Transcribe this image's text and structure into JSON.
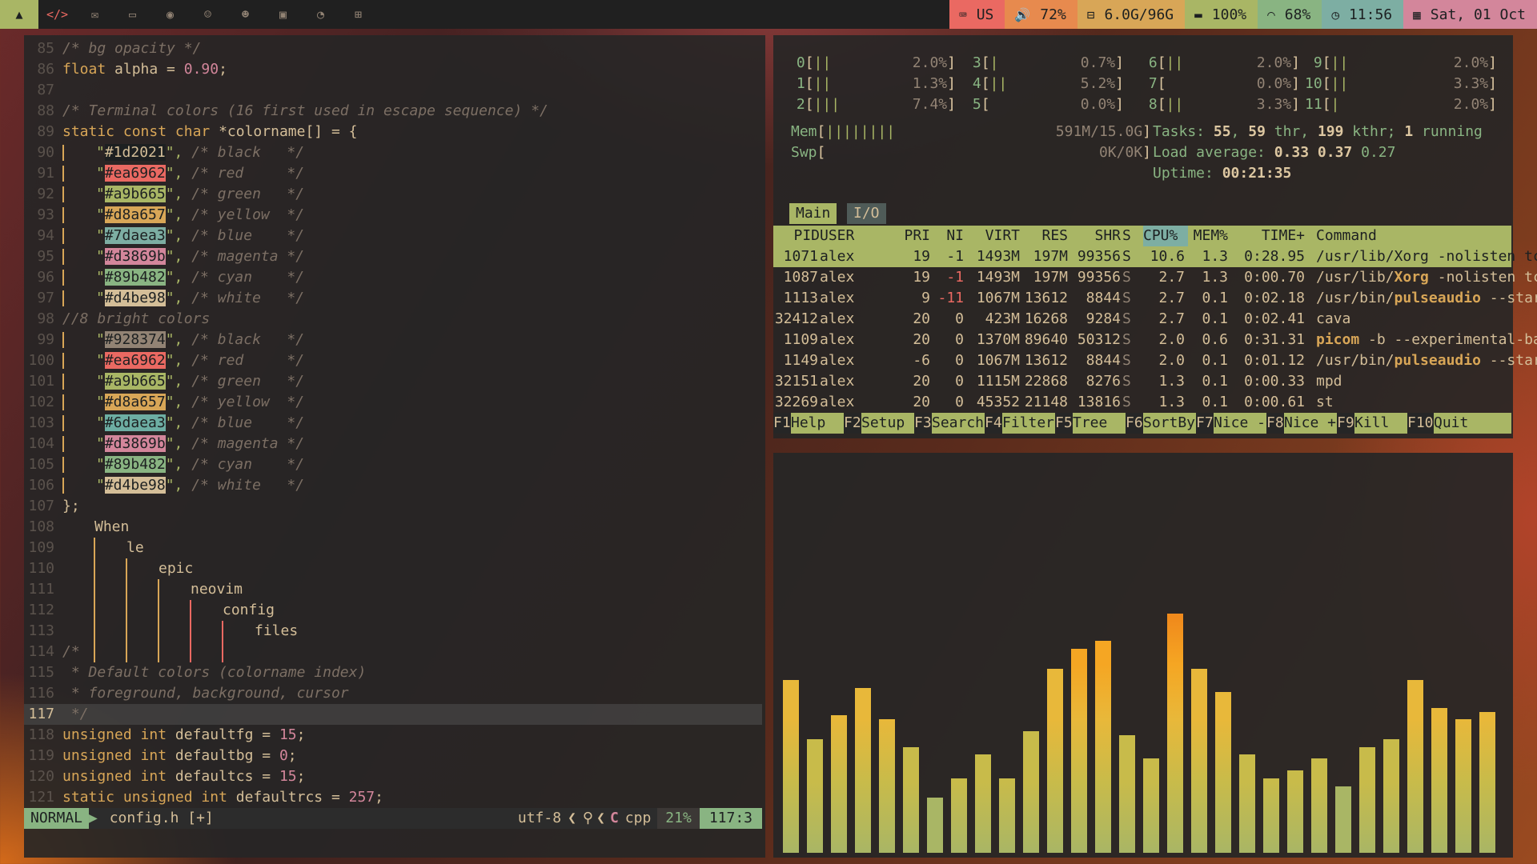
{
  "topbar": {
    "left_icons": [
      "arch-logo-icon",
      "code-icon",
      "mail-icon",
      "folder-icon",
      "eye-icon",
      "discord-icon",
      "github-icon",
      "lock-icon",
      "rss-icon",
      "grid-icon"
    ],
    "keyboard": "US",
    "volume": "72%",
    "disk": "6.0G/96G",
    "battery": "100%",
    "wifi": "68%",
    "time": "11:56",
    "date": "Sat, 01 Oct",
    "colors": {
      "keyboard": "#ea6962",
      "volume": "#e78a4e",
      "disk": "#d8a657",
      "battery": "#a9b665",
      "wifi": "#89b482",
      "time": "#7daea3",
      "date": "#d3869b"
    }
  },
  "editor": {
    "lines": [
      {
        "n": "85"
      },
      {
        "n": "86"
      },
      {
        "n": "87"
      },
      {
        "n": "88"
      },
      {
        "n": "89"
      },
      {
        "n": "90"
      },
      {
        "n": "91"
      },
      {
        "n": "92"
      },
      {
        "n": "93"
      },
      {
        "n": "94"
      },
      {
        "n": "95"
      },
      {
        "n": "96"
      },
      {
        "n": "97"
      },
      {
        "n": "98"
      },
      {
        "n": "99"
      },
      {
        "n": "100"
      },
      {
        "n": "101"
      },
      {
        "n": "102"
      },
      {
        "n": "103"
      },
      {
        "n": "104"
      },
      {
        "n": "105"
      },
      {
        "n": "106"
      },
      {
        "n": "107"
      },
      {
        "n": "108"
      },
      {
        "n": "109"
      },
      {
        "n": "110"
      },
      {
        "n": "111"
      },
      {
        "n": "112"
      },
      {
        "n": "113"
      },
      {
        "n": "114"
      },
      {
        "n": "115"
      },
      {
        "n": "116"
      },
      {
        "n": "117"
      },
      {
        "n": "118"
      },
      {
        "n": "119"
      },
      {
        "n": "120"
      },
      {
        "n": "121"
      }
    ],
    "text": {
      "l85": "/* bg opacity */",
      "l86_kw": "float",
      "l86_rest": " alpha = ",
      "l86_num": "0.90",
      "l86_end": ";",
      "l88": "/* Terminal colors (16 first used in escape sequence) */",
      "l89_a": "static const ",
      "l89_b": "char",
      "l89_c": " *colorname[] = {",
      "l107": "};",
      "l114": "/*",
      "l115": " * Default colors (colorname index)",
      "l116": " * foreground, background, cursor",
      "l117": " */",
      "l118_a": "unsigned ",
      "l118_b": "int",
      "l118_c": " defaultfg = ",
      "l118_num": "15",
      "l118_e": ";",
      "l119_a": "unsigned ",
      "l119_b": "int",
      "l119_c": " defaultbg = ",
      "l119_num": "0",
      "l119_e": ";",
      "l120_a": "unsigned ",
      "l120_b": "int",
      "l120_c": " defaultcs = ",
      "l120_num": "15",
      "l120_e": ";",
      "l121_a": "static unsigned ",
      "l121_b": "int",
      "l121_c": " defaultrcs = ",
      "l121_num": "257",
      "l121_e": ";",
      "l98": "//8 bright colors"
    },
    "colors": [
      {
        "hex": "#1d2021",
        "comment": "/* black   */"
      },
      {
        "hex": "#ea6962",
        "comment": "/* red     */"
      },
      {
        "hex": "#a9b665",
        "comment": "/* green   */"
      },
      {
        "hex": "#d8a657",
        "comment": "/* yellow  */"
      },
      {
        "hex": "#7daea3",
        "comment": "/* blue    */"
      },
      {
        "hex": "#d3869b",
        "comment": "/* magenta */"
      },
      {
        "hex": "#89b482",
        "comment": "/* cyan    */"
      },
      {
        "hex": "#d4be98",
        "comment": "/* white   */"
      }
    ],
    "bright_colors": [
      {
        "hex": "#928374",
        "comment": "/* black   */"
      },
      {
        "hex": "#ea6962",
        "comment": "/* red     */"
      },
      {
        "hex": "#a9b665",
        "comment": "/* green   */"
      },
      {
        "hex": "#d8a657",
        "comment": "/* yellow  */"
      },
      {
        "hex": "#6daea3",
        "comment": "/* blue    */"
      },
      {
        "hex": "#d3869b",
        "comment": "/* magenta */"
      },
      {
        "hex": "#89b482",
        "comment": "/* cyan    */"
      },
      {
        "hex": "#d4be98",
        "comment": "/* white   */"
      }
    ],
    "tree": [
      "When",
      "le",
      "epic",
      "neovim",
      "config",
      "files"
    ],
    "status": {
      "mode": "NORMAL",
      "file": "config.h [+]",
      "encoding": "utf-8",
      "filetype": "cpp",
      "percent": "21%",
      "position": "117:3"
    }
  },
  "htop": {
    "cpus": [
      {
        "id": "0",
        "bar": "||",
        "pct": "2.0%"
      },
      {
        "id": "1",
        "bar": "||",
        "pct": "1.3%"
      },
      {
        "id": "2",
        "bar": "|||",
        "pct": "7.4%"
      },
      {
        "id": "3",
        "bar": "|",
        "pct": "0.7%"
      },
      {
        "id": "4",
        "bar": "||",
        "pct": "5.2%"
      },
      {
        "id": "5",
        "bar": "",
        "pct": "0.0%"
      },
      {
        "id": "6",
        "bar": "||",
        "pct": "2.0%"
      },
      {
        "id": "7",
        "bar": "",
        "pct": "0.0%"
      },
      {
        "id": "8",
        "bar": "||",
        "pct": "3.3%"
      },
      {
        "id": "9",
        "bar": "||",
        "pct": "2.0%"
      },
      {
        "id": "10",
        "bar": "||",
        "pct": "3.3%"
      },
      {
        "id": "11",
        "bar": "|",
        "pct": "2.0%"
      }
    ],
    "mem": {
      "label": "Mem",
      "bar": "||||||||",
      "value": "591M/15.0G"
    },
    "swp": {
      "label": "Swp",
      "value": "0K/0K"
    },
    "tasks": {
      "label": "Tasks: ",
      "tasks": "55",
      "sep": ", ",
      "thr": "59",
      "thr_label": " thr, ",
      "kthr": "199",
      "kthr_label": " kthr; ",
      "running": "1",
      "running_label": " running"
    },
    "load": {
      "label": "Load average: ",
      "a": "0.33",
      "b": "0.37",
      "c": "0.27"
    },
    "uptime": {
      "label": "Uptime: ",
      "value": "00:21:35"
    },
    "tabs": [
      "Main",
      "I/O"
    ],
    "columns": [
      "PID",
      "USER",
      "PRI",
      "NI",
      "VIRT",
      "RES",
      "SHR",
      "S",
      "CPU%",
      "MEM%",
      "TIME+",
      "Command"
    ],
    "processes": [
      {
        "pid": "1071",
        "user": "alex",
        "pri": "19",
        "ni": "-1",
        "virt": "1493M",
        "res": "197M",
        "shr": "99356",
        "s": "S",
        "cpu": "10.6",
        "mem": "1.3",
        "time": "0:28.95",
        "cmd": "/usr/lib/Xorg -nolisten tcp"
      },
      {
        "pid": "1087",
        "user": "alex",
        "pri": "19",
        "ni": "-1",
        "virt": "1493M",
        "res": "197M",
        "shr": "99356",
        "s": "S",
        "cpu": "2.7",
        "mem": "1.3",
        "time": "0:00.70",
        "cmd_a": "/usr/lib/",
        "cmd_b": "Xorg",
        "cmd_c": " -nolisten tcp"
      },
      {
        "pid": "1113",
        "user": "alex",
        "pri": "9",
        "ni": "-11",
        "virt": "1067M",
        "res": "13612",
        "shr": "8844",
        "s": "S",
        "cpu": "2.7",
        "mem": "0.1",
        "time": "0:02.18",
        "cmd_a": "/usr/bin/",
        "cmd_b": "pulseaudio",
        "cmd_c": " --start"
      },
      {
        "pid": "32412",
        "user": "alex",
        "pri": "20",
        "ni": "0",
        "virt": "423M",
        "res": "16268",
        "shr": "9284",
        "s": "S",
        "cpu": "2.7",
        "mem": "0.1",
        "time": "0:02.41",
        "cmd": "cava"
      },
      {
        "pid": "1109",
        "user": "alex",
        "pri": "20",
        "ni": "0",
        "virt": "1370M",
        "res": "89640",
        "shr": "50312",
        "s": "S",
        "cpu": "2.0",
        "mem": "0.6",
        "time": "0:31.31",
        "cmd_b": "picom",
        "cmd_c": " -b --experimental-bac"
      },
      {
        "pid": "1149",
        "user": "alex",
        "pri": "-6",
        "ni": "0",
        "virt": "1067M",
        "res": "13612",
        "shr": "8844",
        "s": "S",
        "cpu": "2.0",
        "mem": "0.1",
        "time": "0:01.12",
        "cmd_a": "/usr/bin/",
        "cmd_b": "pulseaudio",
        "cmd_c": " --start"
      },
      {
        "pid": "32151",
        "user": "alex",
        "pri": "20",
        "ni": "0",
        "virt": "1115M",
        "res": "22868",
        "shr": "8276",
        "s": "S",
        "cpu": "1.3",
        "mem": "0.1",
        "time": "0:00.33",
        "cmd": "mpd"
      },
      {
        "pid": "32269",
        "user": "alex",
        "pri": "20",
        "ni": "0",
        "virt": "45352",
        "res": "21148",
        "shr": "13816",
        "s": "S",
        "cpu": "1.3",
        "mem": "0.1",
        "time": "0:00.61",
        "cmd": "st"
      }
    ],
    "fkeys": [
      {
        "key": "F1",
        "label": "Help  "
      },
      {
        "key": "F2",
        "label": "Setup "
      },
      {
        "key": "F3",
        "label": "Search"
      },
      {
        "key": "F4",
        "label": "Filter"
      },
      {
        "key": "F5",
        "label": "Tree  "
      },
      {
        "key": "F6",
        "label": "SortBy"
      },
      {
        "key": "F7",
        "label": "Nice -"
      },
      {
        "key": "F8",
        "label": "Nice +"
      },
      {
        "key": "F9",
        "label": "Kill  "
      },
      {
        "key": "F10",
        "label": "Quit  "
      }
    ]
  },
  "cava": {
    "levels": [
      0.44,
      0.29,
      0.35,
      0.42,
      0.34,
      0.27,
      0.14,
      0.19,
      0.25,
      0.19,
      0.31,
      0.47,
      0.52,
      0.54,
      0.3,
      0.24,
      0.61,
      0.47,
      0.41,
      0.25,
      0.19,
      0.21,
      0.24,
      0.17,
      0.27,
      0.29,
      0.44,
      0.37,
      0.34,
      0.36
    ],
    "colors": [
      "#a9b665",
      "#c8bb4a",
      "#e8b83a",
      "#f5a623",
      "#f08a1c",
      "#e8631a",
      "#e04a28"
    ]
  }
}
